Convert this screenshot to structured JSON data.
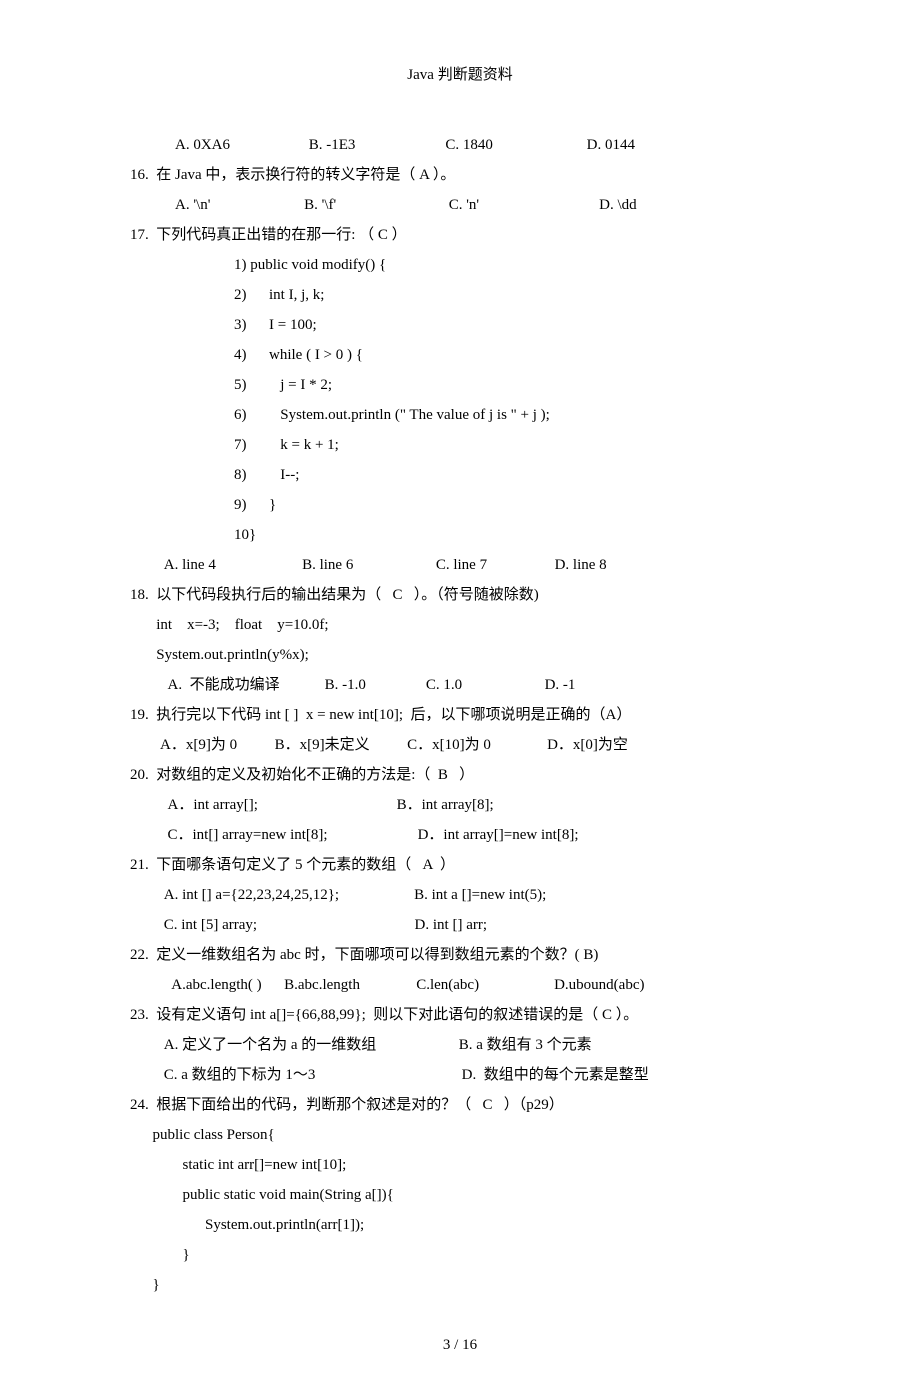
{
  "title": "Java 判断题资料",
  "l1": "            A. 0XA6                     B. -1E3                        C. 1840                         D. 0144",
  "q16": "16.  在 Java 中，表示换行符的转义字符是（ A ）。",
  "q16o": "            A. '\\n'                         B. '\\f'                              C. 'n'                                D. \\dd",
  "q17": "17.  下列代码真正出错的在那一行: （ C ）",
  "q17c1": "1) public void modify() {",
  "q17c2": "2)      int I, j, k;",
  "q17c3": "3)      I = 100;",
  "q17c4": "4)      while ( I > 0 ) {",
  "q17c5": "5)         j = I * 2;",
  "q17c6": "6)         System.out.println (\" The value of j is \" + j );",
  "q17c7": "7)         k = k + 1;",
  "q17c8": "8)         I--;",
  "q17c9": "9)      }",
  "q17c10": "10}",
  "q17o": "         A. line 4                       B. line 6                      C. line 7                  D. line 8",
  "q18": "18.  以下代码段执行后的输出结果为（   C   ）。（符号随被除数)",
  "q18a": "       int    x=-3;    float    y=10.0f;",
  "q18b": "       System.out.println(y%x);",
  "q18o": "          A.  不能成功编译            B. -1.0                C. 1.0                      D. -1",
  "q19": "19.  执行完以下代码 int [ ]  x = new int[10];  后，以下哪项说明是正确的（A）",
  "q19o": "        A．x[9]为 0          B．x[9]未定义          C．x[10]为 0               D．x[0]为空",
  "q20": "20.  对数组的定义及初始化不正确的方法是:（  B   ）",
  "q20a": "          A．int array[];                                     B．int array[8];",
  "q20b": "          C．int[] array=new int[8];                        D．int array[]=new int[8];",
  "q21": "21.  下面哪条语句定义了 5 个元素的数组（   A  ）",
  "q21a": "         A. int [] a={22,23,24,25,12};                    B. int a []=new int(5);",
  "q21b": "         C. int [5] array;                                          D. int [] arr;",
  "q22": "22.  定义一维数组名为 abc 时，下面哪项可以得到数组元素的个数？( B)",
  "q22o": "           A.abc.length( )      B.abc.length               C.len(abc)                    D.ubound(abc)",
  "q23": "23.  设有定义语句 int a[]={66,88,99};  则以下对此语句的叙述错误的是（ C ）。",
  "q23a": "         A. 定义了一个名为 a 的一维数组                      B. a 数组有 3 个元素",
  "q23b": "         C. a 数组的下标为 1～3                                       D.  数组中的每个元素是整型",
  "q24": "24.  根据下面给出的代码，判断那个叙述是对的？（   C   ）（p29）",
  "q24c1": "      public class Person{",
  "q24c2": "              static int arr[]=new int[10];",
  "q24c3": "              public static void main(String a[]){",
  "q24c4": "                    System.out.println(arr[1]);",
  "q24c5": "              }",
  "q24c6": "      }",
  "footer": "3  /  16"
}
